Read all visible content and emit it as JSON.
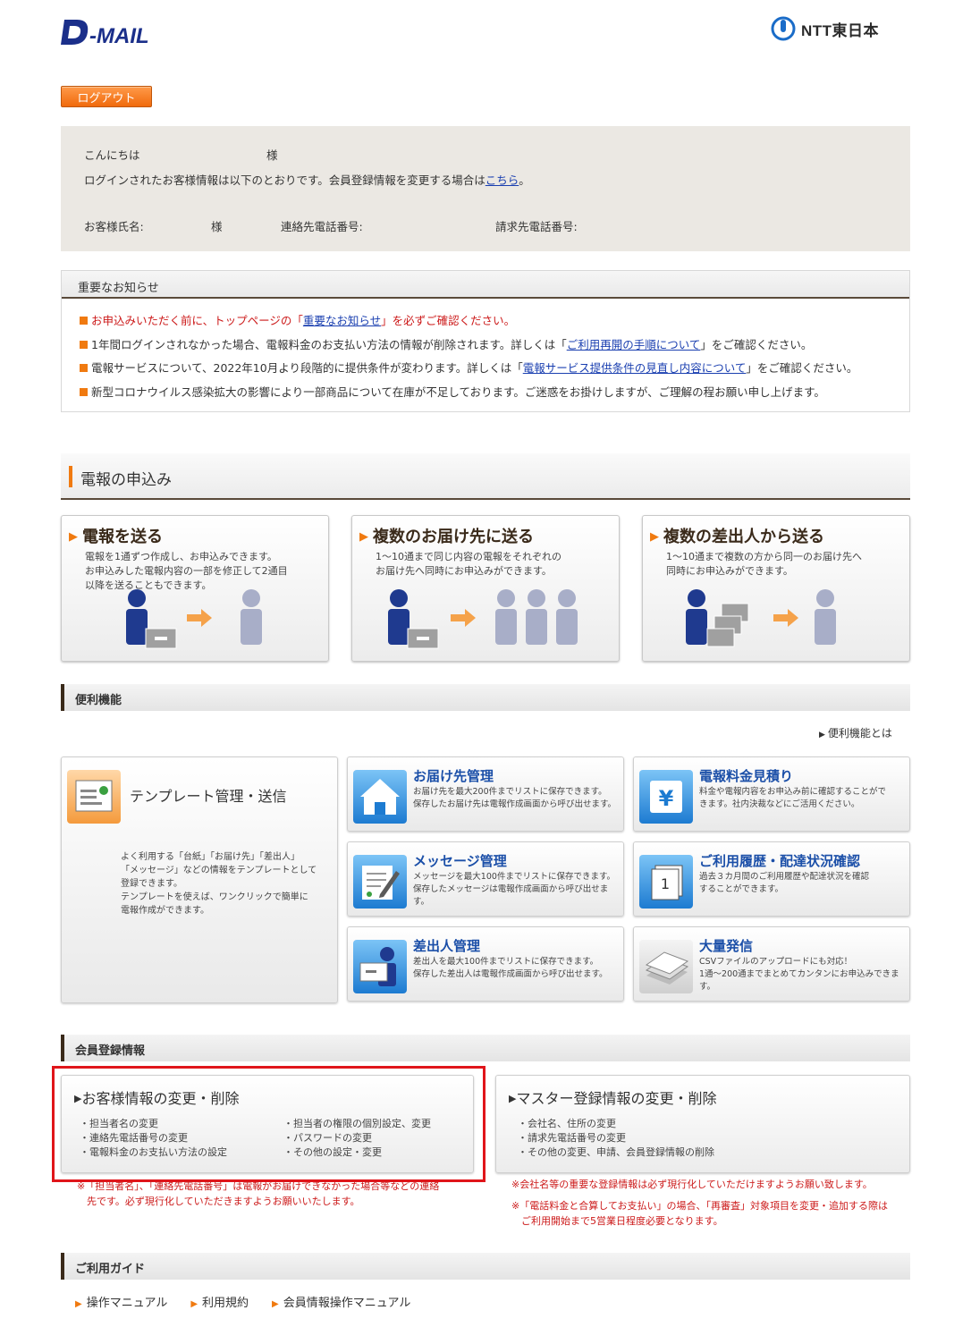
{
  "header": {
    "logo_text": "D-MAIL",
    "provider": "NTT東日本",
    "logout_label": "ログアウト"
  },
  "welcome": {
    "greeting": "こんにちは",
    "honorific": "様",
    "info_text": "ログインされたお客様情報は以下のとおりです。会員登録情報を変更する場合は",
    "info_link": "こちら",
    "info_suffix": "。",
    "name_label": "お客様氏名:",
    "name_honorific": "様",
    "contact_phone_label": "連絡先電話番号:",
    "billing_phone_label": "請求先電話番号:"
  },
  "notice": {
    "title": "重要なお知らせ",
    "items": [
      {
        "pre": "お申込みいただく前に、トップページの「",
        "link": "重要なお知らせ",
        "post": "」を必ずご確認ください。"
      },
      {
        "pre": "1年間ログインされなかった場合、電報料金のお支払い方法の情報が削除されます。詳しくは「",
        "link": "ご利用再開の手順について",
        "post": "」をご確認ください。"
      },
      {
        "pre": "電報サービスについて、2022年10月より段階的に提供条件が変わります。詳しくは「",
        "link": "電報サービス提供条件の見直し内容について",
        "post": "」をご確認ください。"
      },
      {
        "pre": "新型コロナウイルス感染拡大の影響により一部商品について在庫が不足しております。ご迷惑をお掛けしますが、ご理解の程お願い申し上げます。",
        "link": "",
        "post": ""
      }
    ]
  },
  "apply": {
    "title": "電報の申込み",
    "cards": [
      {
        "title": "電報を送る",
        "desc": "電報を1通ずつ作成し、お申込みできます。\nお申込みした電報内容の一部を修正して2通目\n以降を送ることもできます。"
      },
      {
        "title": "複数のお届け先に送る",
        "desc": "1〜10通まで同じ内容の電報をそれぞれの\nお届け先へ同時にお申込みができます。"
      },
      {
        "title": "複数の差出人から送る",
        "desc": "1〜10通まで複数の方から同一のお届け先へ\n同時にお申込みができます。"
      }
    ]
  },
  "features": {
    "title": "便利機能",
    "more_link": "便利機能とは",
    "template": {
      "title": "テンプレート管理・送信",
      "desc": "よく利用する「台紙」「お届け先」「差出人」\n「メッセージ」などの情報をテンプレートとして\n登録できます。\nテンプレートを使えば、ワンクリックで簡単に\n電報作成ができます。"
    },
    "items": [
      {
        "title": "お届け先管理",
        "desc": "お届け先を最大200件までリストに保存できます。\n保存したお届け先は電報作成画面から呼び出せます。"
      },
      {
        "title": "電報料金見積り",
        "desc": "料金や電報内容をお申込み前に確認することがで\nきます。社内決裁などにご活用ください。"
      },
      {
        "title": "メッセージ管理",
        "desc": "メッセージを最大100件までリストに保存できます。\n保存したメッセージは電報作成画面から呼び出せます。"
      },
      {
        "title": "ご利用履歴・配達状況確認",
        "desc": "過去３カ月間のご利用履歴や配達状況を確認\nすることができます。"
      },
      {
        "title": "差出人管理",
        "desc": "差出人を最大100件までリストに保存できます。\n保存した差出人は電報作成画面から呼び出せます。"
      },
      {
        "title": "大量発信",
        "desc": "CSVファイルのアップロードにも対応！\n1通〜200通までまとめてカンタンにお申込みできます。"
      }
    ]
  },
  "member": {
    "title": "会員登録情報",
    "customer": {
      "title": "お客様情報の変更・削除",
      "left": "・担当者名の変更\n・連絡先電話番号の変更\n・電報料金のお支払い方法の設定",
      "right": "・担当者の権限の個別設定、変更\n・パスワードの変更\n・その他の設定・変更",
      "note": "※「担当者名」、「連絡先電話番号」は電報がお届けできなかった場合等などの連絡\n　先です。必ず現行化していただきますようお願いいたします。"
    },
    "master": {
      "title": "マスター登録情報の変更・削除",
      "list": "・会社名、住所の変更\n・請求先電話番号の変更\n・その他の変更、申請、会員登録情報の削除",
      "note1": "※会社名等の重要な登録情報は必ず現行化していただけますようお願い致します。",
      "note2": "※「電話料金と合算してお支払い」の場合、「再審査」対象項目を変更・追加する際は\n　ご利用開始まで5営業日程度必要となります。"
    }
  },
  "guide": {
    "title": "ご利用ガイド",
    "links": [
      "操作マニュアル",
      "利用規約",
      "会員情報操作マニュアル"
    ]
  },
  "colors": {
    "accent": "#f07a10",
    "brand": "#1b2f8a",
    "alert": "#cc1a1a",
    "highlight": "#e0151a"
  }
}
